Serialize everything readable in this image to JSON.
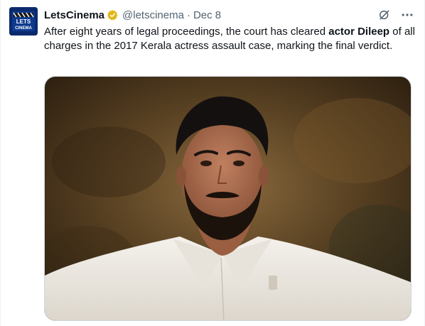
{
  "author": {
    "name": "LetsCinema",
    "handle": "@letscinema",
    "separator": "·",
    "date": "Dec 8",
    "avatar_text_top": "LETS",
    "avatar_text_bottom": "CINEMA"
  },
  "icons": {
    "verified": "verified-badge-icon",
    "grok": "grok-icon",
    "more": "more-icon"
  },
  "tweet": {
    "text_before": "After eight years of legal proceedings, the court has cleared ",
    "text_bold": "actor Dileep",
    "text_after": " of all charges in the 2017 Kerala actress assault case, marking the final verdict."
  },
  "colors": {
    "verified_gold": "#e2b719",
    "avatar_bg": "#0a2a6b",
    "secondary_text": "#536471"
  }
}
